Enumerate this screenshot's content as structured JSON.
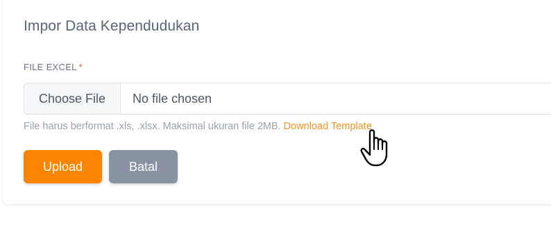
{
  "form": {
    "title": "Impor Data Kependudukan",
    "field_label": "FILE EXCEL",
    "required_mark": "*",
    "file_input": {
      "button_label": "Choose File",
      "status": "No file chosen"
    },
    "help_text": "File harus berformat .xls, .xlsx. Maksimal ukuran file 2MB.",
    "download_link": "Download Template"
  },
  "actions": {
    "upload_label": "Upload",
    "cancel_label": "Batal"
  },
  "colors": {
    "accent": "#fb8500",
    "link": "#f7931e",
    "cancel": "#8993a4",
    "required": "#f2542d"
  },
  "icons": {
    "cursor": "hand-pointer-icon"
  }
}
